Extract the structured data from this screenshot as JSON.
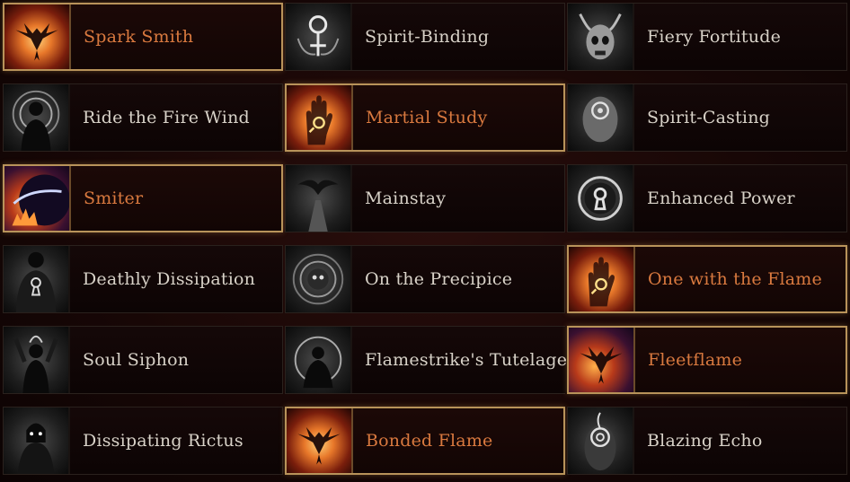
{
  "colors": {
    "active_text": "#d9793f",
    "inactive_text": "#d8d2c8",
    "active_border": "#b8935a",
    "panel_bg": "#0e0606"
  },
  "nodes": [
    {
      "label": "Spark Smith",
      "icon": "phoenix-icon",
      "active": true
    },
    {
      "label": "Spirit-Binding",
      "icon": "spirit-sigil-icon",
      "active": false
    },
    {
      "label": "Fiery Fortitude",
      "icon": "horned-skull-icon",
      "active": false
    },
    {
      "label": "Ride the Fire Wind",
      "icon": "silhouette-aura-icon",
      "active": false
    },
    {
      "label": "Martial Study",
      "icon": "burning-hand-icon",
      "active": true
    },
    {
      "label": "Spirit-Casting",
      "icon": "head-eye-icon",
      "active": false
    },
    {
      "label": "Smiter",
      "icon": "eclipse-fire-icon",
      "active": true
    },
    {
      "label": "Mainstay",
      "icon": "crow-bridge-icon",
      "active": false
    },
    {
      "label": "Enhanced Power",
      "icon": "keyhole-circle-icon",
      "active": false
    },
    {
      "label": "Deathly Dissipation",
      "icon": "keyhole-figure-icon",
      "active": false
    },
    {
      "label": "On the Precipice",
      "icon": "vortex-skull-icon",
      "active": false
    },
    {
      "label": "One with the Flame",
      "icon": "burning-hand-icon",
      "active": true
    },
    {
      "label": "Soul Siphon",
      "icon": "raised-arms-figure-icon",
      "active": false
    },
    {
      "label": "Flamestrike's Tutelage",
      "icon": "meditating-figure-icon",
      "active": false
    },
    {
      "label": "Fleetflame",
      "icon": "phoenix-icon",
      "active": true
    },
    {
      "label": "Dissipating Rictus",
      "icon": "grim-figure-icon",
      "active": false
    },
    {
      "label": "Bonded Flame",
      "icon": "phoenix-icon",
      "active": true
    },
    {
      "label": "Blazing Echo",
      "icon": "spiral-head-icon",
      "active": false
    }
  ]
}
